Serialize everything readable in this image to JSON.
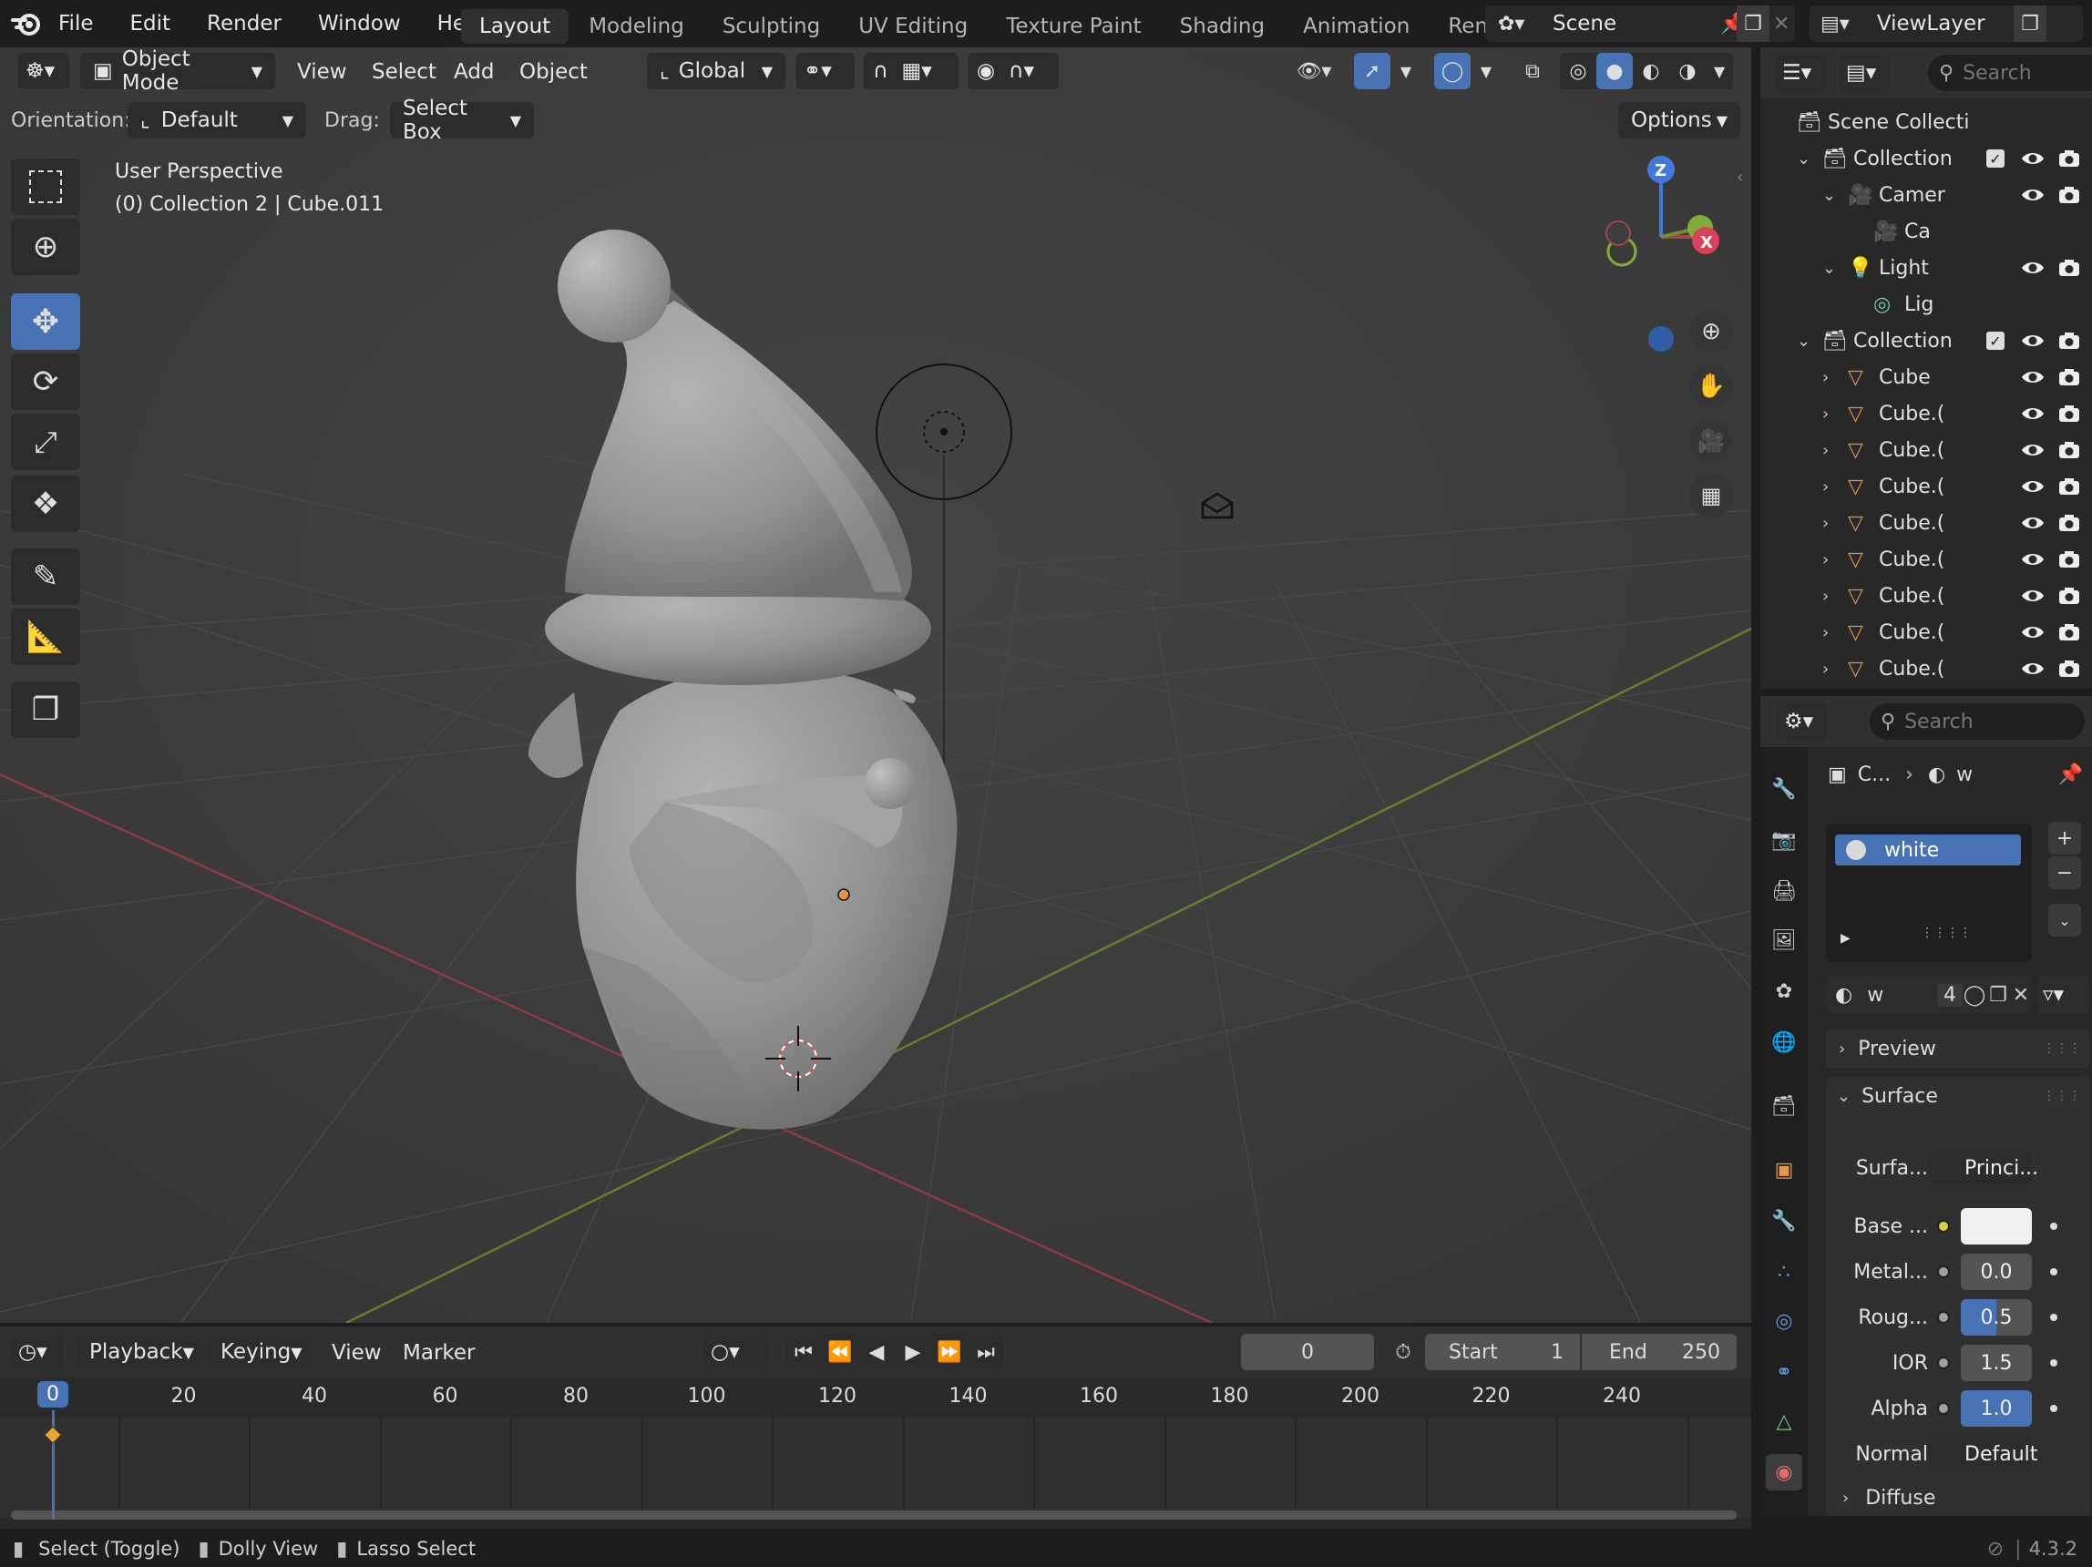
{
  "topbar": {
    "menus": [
      "File",
      "Edit",
      "Render",
      "Window",
      "Help"
    ],
    "workspaces": [
      "Layout",
      "Modeling",
      "Sculpting",
      "UV Editing",
      "Texture Paint",
      "Shading",
      "Animation",
      "Rendering"
    ],
    "active_workspace": "Layout",
    "scene": "Scene",
    "view_layer": "ViewLayer"
  },
  "viewport_header": {
    "mode": "Object Mode",
    "menus": [
      "View",
      "Select",
      "Add",
      "Object"
    ],
    "transform_orientation": "Global"
  },
  "tool_settings": {
    "orientation_label": "Orientation:",
    "orientation_value": "Default",
    "drag_label": "Drag:",
    "drag_value": "Select Box",
    "options_label": "Options"
  },
  "viewport": {
    "perspective": "User Perspective",
    "context": "(0) Collection 2 | Cube.011",
    "gizmo": {
      "z": "Z",
      "x": "X"
    }
  },
  "outliner": {
    "search_placeholder": "Search",
    "rows": [
      {
        "label": "Scene Collecti",
        "type": "scene"
      },
      {
        "label": "Collection",
        "type": "collection"
      },
      {
        "label": "Camer",
        "type": "camera"
      },
      {
        "label": "Ca",
        "type": "camera-data"
      },
      {
        "label": "Light",
        "type": "light"
      },
      {
        "label": "Lig",
        "type": "light-data"
      },
      {
        "label": "Collection",
        "type": "collection"
      },
      {
        "label": "Cube",
        "type": "mesh"
      },
      {
        "label": "Cube.(",
        "type": "mesh"
      },
      {
        "label": "Cube.(",
        "type": "mesh"
      },
      {
        "label": "Cube.(",
        "type": "mesh"
      },
      {
        "label": "Cube.(",
        "type": "mesh"
      },
      {
        "label": "Cube.(",
        "type": "mesh"
      },
      {
        "label": "Cube.(",
        "type": "mesh"
      },
      {
        "label": "Cube.(",
        "type": "mesh"
      },
      {
        "label": "Cube.(",
        "type": "mesh"
      }
    ]
  },
  "properties": {
    "search_placeholder": "Search",
    "breadcrumb_object": "C...",
    "breadcrumb_material": "w",
    "material_slot": "white",
    "material_name": "w",
    "material_users": "4",
    "panels": {
      "preview": "Preview",
      "surface": "Surface",
      "diffuse": "Diffuse"
    },
    "surface": {
      "surface_label": "Surfa...",
      "surface_value": "Princi...",
      "base_color_label": "Base ...",
      "metallic_label": "Metal...",
      "metallic_value": "0.0",
      "roughness_label": "Roug...",
      "roughness_value": "0.5",
      "roughness_fraction": 0.5,
      "ior_label": "IOR",
      "ior_value": "1.5",
      "alpha_label": "Alpha",
      "alpha_value": "1.0",
      "alpha_fraction": 1.0,
      "normal_label": "Normal",
      "normal_value": "Default"
    },
    "base_color": "#f0f0f0"
  },
  "timeline": {
    "menus": [
      "Playback",
      "Keying",
      "View",
      "Marker"
    ],
    "current_frame": "0",
    "start_label": "Start",
    "start_value": "1",
    "end_label": "End",
    "end_value": "250",
    "ruler": [
      "0",
      "20",
      "40",
      "60",
      "80",
      "100",
      "120",
      "140",
      "160",
      "180",
      "200",
      "220",
      "240"
    ]
  },
  "statusbar": {
    "items": [
      "Select (Toggle)",
      "Dolly View",
      "Lasso Select"
    ],
    "version": "4.3.2"
  },
  "colors": {
    "accent": "#4772b3",
    "x_axis": "#a8434e",
    "y_axis": "#6f8f2d",
    "z_axis": "#3f7ad9",
    "mesh_icon": "#e5944b"
  }
}
